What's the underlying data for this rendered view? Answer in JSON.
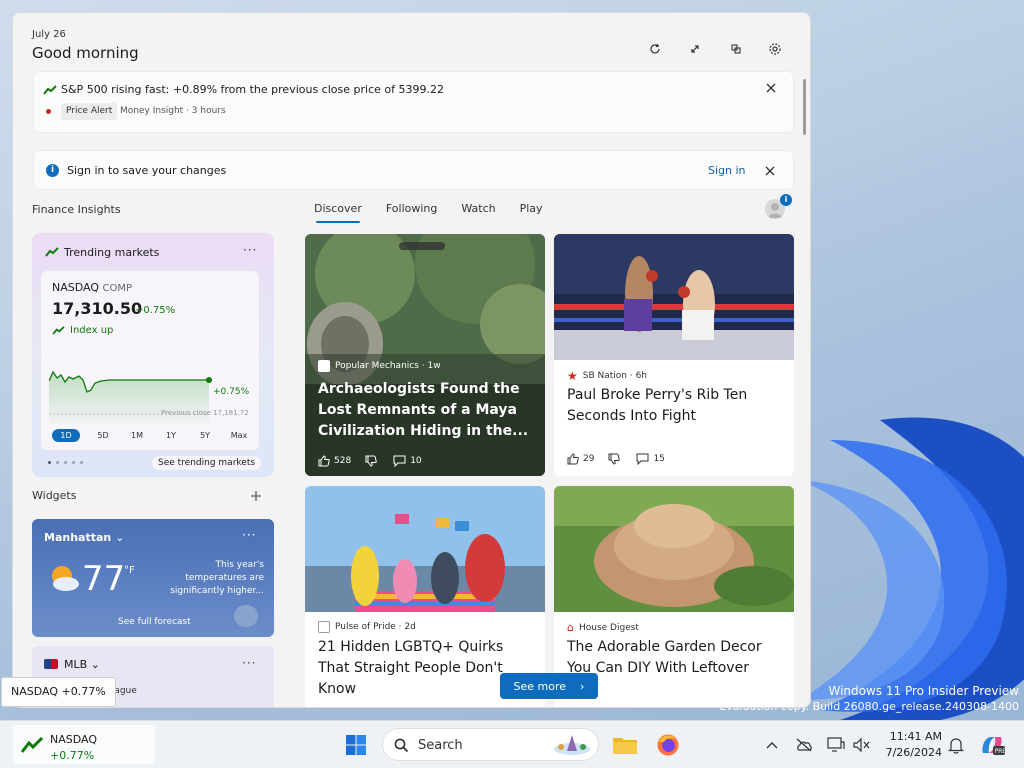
{
  "header": {
    "date": "July 26",
    "greeting": "Good morning"
  },
  "alert": {
    "text": "S&P 500 rising fast: +0.89% from the previous close price of 5399.22",
    "tag": "Price Alert",
    "meta": "Money Insight · 3 hours"
  },
  "signin": {
    "text": "Sign in to save your changes",
    "link": "Sign in"
  },
  "sections": {
    "finance": "Finance Insights",
    "widgets": "Widgets"
  },
  "feed_tabs": [
    {
      "label": "Discover"
    },
    {
      "label": "Following"
    },
    {
      "label": "Watch"
    },
    {
      "label": "Play"
    }
  ],
  "avatar_badge": "i",
  "finance": {
    "title": "Trending markets",
    "more": "···",
    "name": "NASDAQ",
    "code": "COMP",
    "price": "17,310.50",
    "change": "+0.75%",
    "status": "Index up",
    "chart_change": "+0.75%",
    "prev_close": "Previous close 17,181.72",
    "ranges": [
      "1D",
      "5D",
      "1M",
      "1Y",
      "5Y",
      "Max"
    ],
    "see_link": "See trending markets",
    "accent": "#0e7a0d"
  },
  "weather": {
    "location": "Manhattan",
    "more": "···",
    "temp": "77",
    "unit": "°F",
    "note": "This year's temperatures are significantly higher...",
    "link": "See full forecast"
  },
  "mlb": {
    "title": "MLB",
    "more": "···",
    "text": "this league"
  },
  "news": [
    {
      "source": "Popular Mechanics · 1w",
      "title": "Archaeologists Found the Lost Remnants of a Maya Civilization Hiding in the...",
      "likes": "528",
      "comments": "10"
    },
    {
      "source": "SB Nation · 6h",
      "title": "Paul Broke Perry's Rib Ten Seconds Into Fight",
      "likes": "29",
      "comments": "15"
    },
    {
      "source": "Pulse of Pride · 2d",
      "title": "21 Hidden LGBTQ+ Quirks That Straight People Don't Know"
    },
    {
      "source": "House Digest",
      "title": "The Adorable Garden Decor You Can DIY With Leftover ...ks"
    }
  ],
  "see_more": "See more",
  "tooltip": "NASDAQ +0.77%",
  "taskbar": {
    "widget_name": "NASDAQ",
    "widget_value": "+0.77%",
    "search_placeholder": "Search",
    "time": "11:41 AM",
    "date": "7/26/2024"
  },
  "watermark": {
    "line1": "Windows 11 Pro Insider Preview",
    "line2": "Evaluation copy. Build 26080.ge_release.240308-1400"
  }
}
